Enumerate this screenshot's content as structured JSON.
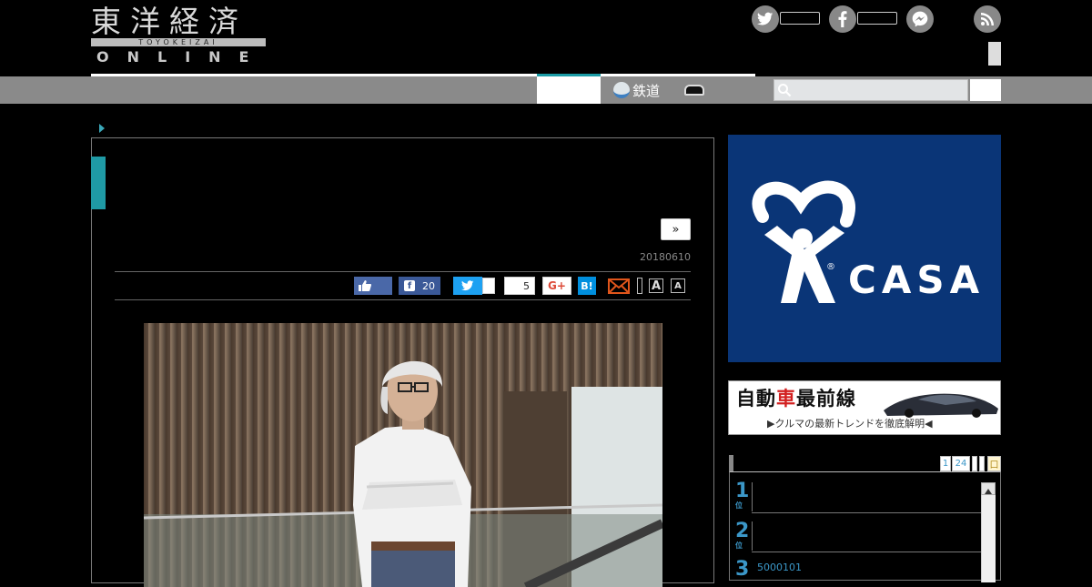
{
  "header": {
    "logo_kanji": "東洋経済",
    "logo_sub": "TOYOKEIZAI",
    "logo_online": "ONLINE"
  },
  "nav": {
    "items": [
      {
        "label": "鉄道",
        "icon": "train-icon"
      },
      {
        "label": "",
        "icon": "car-icon"
      }
    ],
    "search_placeholder": ""
  },
  "article": {
    "next_label": "»",
    "date": "20180610",
    "share": {
      "facebook_count": "20",
      "count_5": "5",
      "gplus_label": "G+",
      "hatena_label": "B!"
    },
    "font_sizes": [
      "A",
      "A"
    ]
  },
  "sidebar": {
    "ad_casa": {
      "brand": "CASA"
    },
    "ad_car": {
      "title_part1": "自動",
      "title_red": "車",
      "title_part2": "最前線",
      "subtitle": "▶クルマの最新トレンドを徹底解明◀"
    },
    "ranking": {
      "tabs": [
        "1",
        "24",
        "",
        "",
        "口"
      ],
      "items": [
        {
          "rank": "1",
          "suffix": "位",
          "text": ""
        },
        {
          "rank": "2",
          "suffix": "位",
          "text": ""
        },
        {
          "rank": "3",
          "suffix": "位",
          "text": "5000101"
        }
      ]
    }
  },
  "colors": {
    "accent_teal": "#1f9aa5",
    "nav_gray": "#8a8a8a",
    "casa_blue": "#0a3577",
    "rank_blue": "#3b97c8"
  }
}
